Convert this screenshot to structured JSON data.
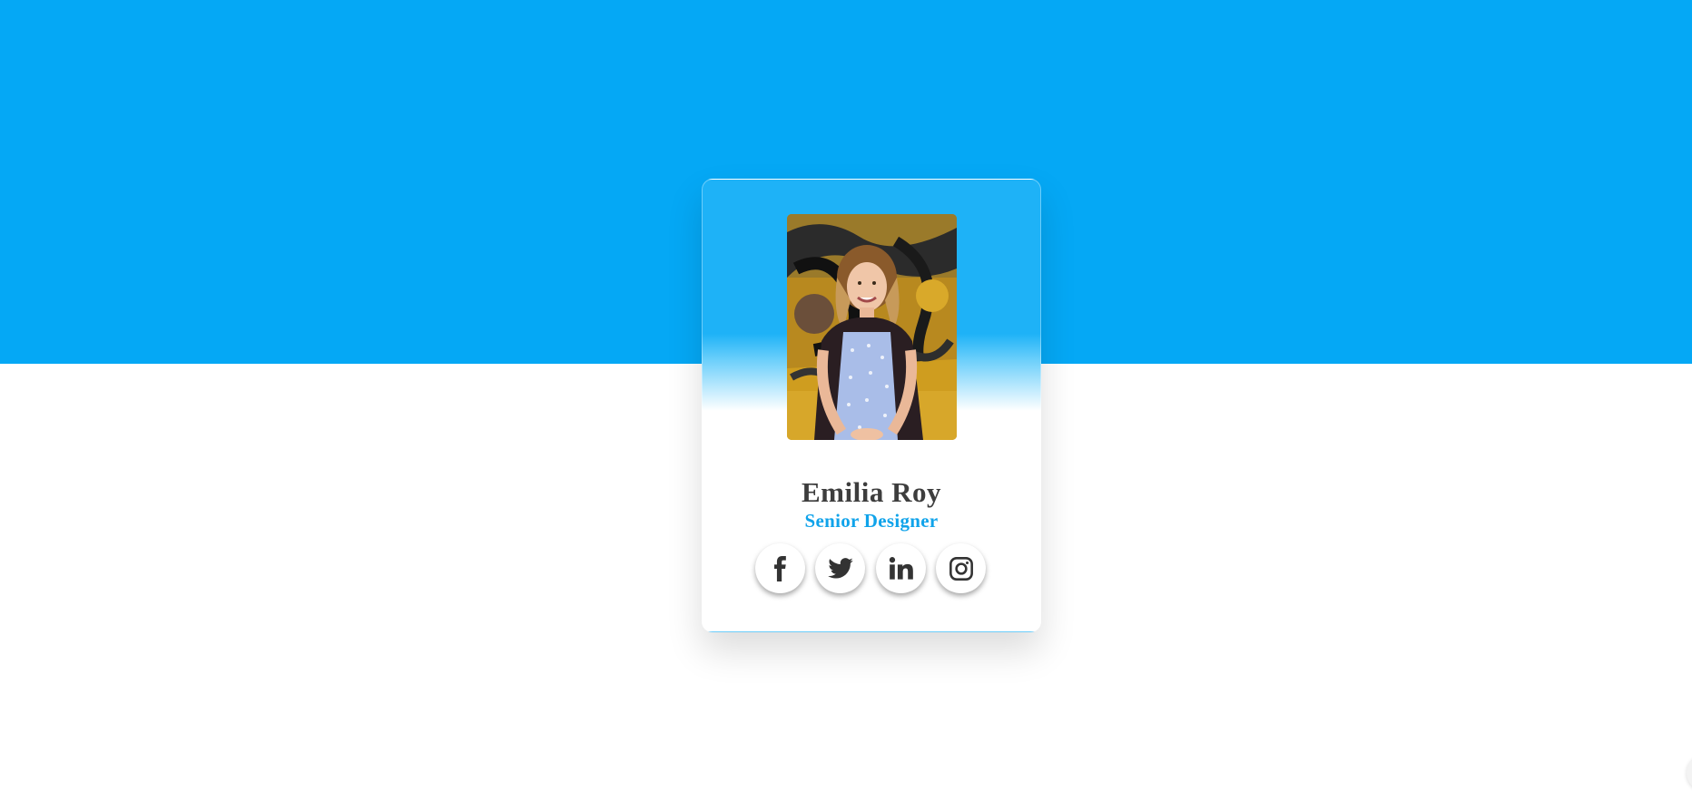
{
  "colors": {
    "top_band": "#05a8f5",
    "card_top": "#1eb2f7",
    "name_text": "#3d3d3d",
    "role_text": "#10a3ea",
    "icon_color": "#333333"
  },
  "profile": {
    "name": "Emilia Roy",
    "role": "Senior Designer",
    "photo_alt": "portrait-photo"
  },
  "socials": [
    {
      "icon": "facebook-icon"
    },
    {
      "icon": "twitter-icon"
    },
    {
      "icon": "linkedin-icon"
    },
    {
      "icon": "instagram-icon"
    }
  ]
}
